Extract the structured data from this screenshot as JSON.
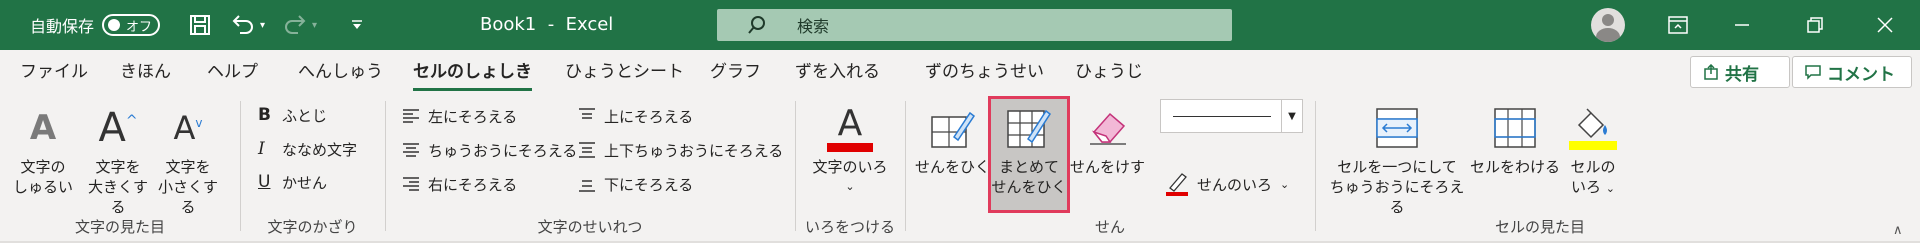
{
  "titlebar": {
    "autosave_label": "自動保存",
    "autosave_state": "オフ",
    "title": "Book1  -  Excel",
    "search_placeholder": "検索"
  },
  "tabs": [
    {
      "label": "ファイル"
    },
    {
      "label": "きほん"
    },
    {
      "label": "ヘルプ"
    },
    {
      "label": "へんしゅう"
    },
    {
      "label": "セルのしょしき"
    },
    {
      "label": "ひょうとシート"
    },
    {
      "label": "グラフ"
    },
    {
      "label": "ずを入れる"
    },
    {
      "label": "ずのちょうせい"
    },
    {
      "label": "ひょうじ"
    }
  ],
  "share_label": "共有",
  "comment_label": "コメント",
  "ribbon": {
    "font_group": {
      "label": "文字の見た目",
      "btn_font_type": [
        "文字の",
        "しゅるい"
      ],
      "btn_grow": [
        "文字を",
        "大きくする"
      ],
      "btn_shrink": [
        "文字を",
        "小さくする"
      ]
    },
    "decor_group": {
      "label": "文字のかざり",
      "bold": "ふとじ",
      "italic": "ななめ文字",
      "underline": "かせん"
    },
    "align_group": {
      "label": "文字のせいれつ",
      "left": "左にそろえる",
      "center": "ちゅうおうにそろえる",
      "right": "右にそろえる",
      "top": "上にそろえる",
      "middle": "上下ちゅうおうにそろえる",
      "bottom": "下にそろえる"
    },
    "color_group": {
      "label": "いろをつける",
      "font_color": "文字のいろ",
      "font_color_swatch": "#e00000"
    },
    "border_group": {
      "label": "せん",
      "draw": "せんをひく",
      "draw_grid": [
        "まとめて",
        "せんをひく"
      ],
      "erase": "せんをけす",
      "line_color": "せんのいろ",
      "line_color_swatch": "#e00000"
    },
    "cell_group": {
      "label": "セルの見た目",
      "merge": [
        "セルを一つにして",
        "ちゅうおうにそろえる"
      ],
      "split": "セルをわける",
      "fill": [
        "セルの",
        "いろ"
      ],
      "fill_swatch": "#ffff00"
    }
  }
}
